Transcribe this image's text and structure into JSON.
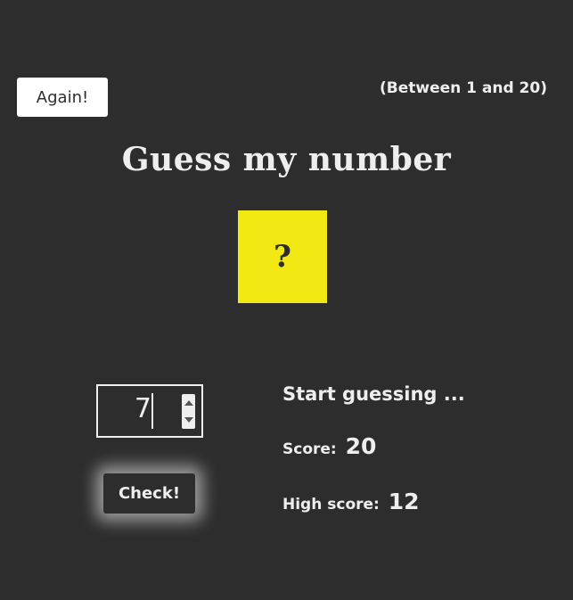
{
  "again_button": "Again!",
  "range_hint": "(Between 1 and 20)",
  "title": "Guess my number",
  "secret_display": "?",
  "guess_input": {
    "value": "7"
  },
  "check_button": "Check!",
  "message": "Start guessing ...",
  "score": {
    "label": "Score:",
    "value": "20"
  },
  "highscore": {
    "label": "High score:",
    "value": "12"
  },
  "colors": {
    "background": "#2d2d2d",
    "text": "#eeeeee",
    "number_box": "#f2e814"
  },
  "icons": {
    "spinner_up": "triangle-up-icon",
    "spinner_down": "triangle-down-icon"
  }
}
